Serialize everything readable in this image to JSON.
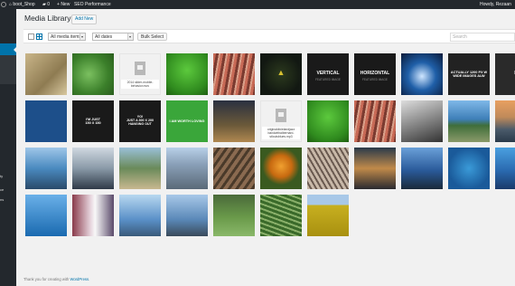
{
  "adminbar": {
    "site_name": "boot_Shop",
    "comments_count": "0",
    "new_label": "New",
    "seo_label": "SEO",
    "perf_label": "Performance",
    "howdy": "Howdy, Rezaan"
  },
  "sidebar": {
    "items": [
      "",
      "",
      "",
      "",
      "",
      "",
      "",
      "",
      "",
      "",
      "",
      "",
      "",
      "ty",
      "",
      "ce",
      "",
      "ns",
      "",
      ""
    ]
  },
  "header": {
    "title": "Media Library",
    "add_new": "Add New"
  },
  "toolbar": {
    "filter_type": "All media items",
    "filter_date": "All dates",
    "bulk_select": "Bulk Select",
    "search_placeholder": "Search"
  },
  "tiles": [
    {
      "kind": "image",
      "name": "glasses-on-book",
      "bg": "linear-gradient(135deg,#c9b589,#8e7b52 60%,#d8c9a0)"
    },
    {
      "kind": "image",
      "name": "green-fern",
      "bg": "radial-gradient(circle at 40% 50%,#7bc060,#3b7f2a 60%,#2b5e1e)"
    },
    {
      "kind": "file",
      "name": "video-file",
      "label": "2014 slider-mobile-behavior.mov"
    },
    {
      "kind": "image",
      "name": "green-dew",
      "bg": "radial-gradient(circle at 50% 40%,#5cc93d,#2f8a1e 70%,#1f5f12)"
    },
    {
      "kind": "image",
      "name": "red-coral",
      "bg": "repeating-linear-gradient(100deg,#c86a56 0 3px,#7b3b30 3px 6px,#d9a08a 6px 8px)"
    },
    {
      "kind": "image",
      "name": "triforce-dark",
      "bg": "radial-gradient(circle,#2c3a1e,#121812 70%)",
      "glyph": "▲"
    },
    {
      "kind": "image",
      "name": "vertical-featured",
      "bg": "#1a1a1a",
      "text": "VERTICAL",
      "sub": "FEATURED IMAGE"
    },
    {
      "kind": "image",
      "name": "horizontal-featured",
      "bg": "#1a1a1a",
      "text": "HORIZONTAL",
      "sub": "FEATURED IMAGE"
    },
    {
      "kind": "image",
      "name": "unicorn",
      "bg": "radial-gradient(circle at 50% 55%,#cfe6ff,#1f5fa8 45%,#0a1a3a)"
    },
    {
      "kind": "image",
      "name": "wide-image-text",
      "bg": "#222",
      "text": "ACTUALLY 1200 PX W\nWIDE IMAGES ALW"
    },
    {
      "kind": "image",
      "name": "partial-dark",
      "bg": "#2a2a2a",
      "text": "R"
    },
    {
      "kind": "image",
      "name": "blue-tile",
      "bg": "#1d4f8a"
    },
    {
      "kind": "image",
      "name": "150x150",
      "bg": "#1a1a1a",
      "text": "I'M JUST\n150 X 150"
    },
    {
      "kind": "image",
      "name": "300x200",
      "bg": "#1a1a1a",
      "text": "YO!\nJUST A 300 X 200\nHANGING OUT"
    },
    {
      "kind": "image",
      "name": "green-text",
      "bg": "#3aa63a",
      "text": "I AM WORTH LOVING"
    },
    {
      "kind": "image",
      "name": "city-night",
      "bg": "linear-gradient(180deg,#2a3040,#6c5a3a 60%,#b08850)"
    },
    {
      "kind": "file",
      "name": "audio-file",
      "label": "originaldixielandjazz bandwithalbernard-stlouisblues.mp3"
    },
    {
      "kind": "image",
      "name": "green-dew-2",
      "bg": "radial-gradient(circle at 50% 40%,#5cc93d,#2f8a1e 70%,#1f5f12)"
    },
    {
      "kind": "image",
      "name": "red-coral-2",
      "bg": "repeating-linear-gradient(100deg,#c86a56 0 3px,#7b3b30 3px 6px,#d9a08a 6px 8px)"
    },
    {
      "kind": "image",
      "name": "bw-landscape",
      "bg": "linear-gradient(160deg,#ddd,#888 50%,#333)"
    },
    {
      "kind": "image",
      "name": "coast-cliffs",
      "bg": "linear-gradient(180deg,#7fb8e8,#3e7fb8 45%,#3f6e3a 60%,#8a9a6a)"
    },
    {
      "kind": "image",
      "name": "sunset-shore",
      "bg": "linear-gradient(180deg,#e8a060,#c08a5a 40%,#4a5a6a 70%,#2a3a4a)"
    },
    {
      "kind": "image",
      "name": "sea-cliffs",
      "bg": "linear-gradient(180deg,#9fc6e8,#4a8ac0 50%,#2a4a6a)"
    },
    {
      "kind": "image",
      "name": "misty-lake",
      "bg": "linear-gradient(180deg,#d0d8e0,#8a9aa8 50%,#2f3a48)"
    },
    {
      "kind": "image",
      "name": "beach-arch",
      "bg": "linear-gradient(180deg,#9ac0d8,#6a8a5a 50%,#c8b890)"
    },
    {
      "kind": "image",
      "name": "rocky-shore",
      "bg": "linear-gradient(180deg,#b8d0e8,#8aa0b8 40%,#5a6a78)"
    },
    {
      "kind": "image",
      "name": "wood-boardwalk",
      "bg": "repeating-linear-gradient(125deg,#8a6a50 0 4px,#4a3a2a 4px 7px)"
    },
    {
      "kind": "image",
      "name": "orange-lily",
      "bg": "radial-gradient(circle at 50% 45%,#f0a030,#c86a10 35%,#3a5a20 60%)"
    },
    {
      "kind": "image",
      "name": "metal-structure",
      "bg": "repeating-linear-gradient(60deg,#c8b8a8 0 3px,#6a5a50 3px 5px)"
    },
    {
      "kind": "image",
      "name": "sunset-water",
      "bg": "linear-gradient(180deg,#2a3a4a,#c08a4a 50%,#2a2a30)"
    },
    {
      "kind": "image",
      "name": "harbour-bridge",
      "bg": "linear-gradient(180deg,#6aa0d8,#2a5a9a 55%,#1a2a3a)"
    },
    {
      "kind": "image",
      "name": "blue-water",
      "bg": "radial-gradient(circle,#3a9ad8,#1a5a9a 70%)"
    },
    {
      "kind": "image",
      "name": "city-skyline",
      "bg": "linear-gradient(180deg,#4aa0e0,#2a6ab0 55%,#1a3a6a)"
    },
    {
      "kind": "image",
      "name": "blue-sea",
      "bg": "linear-gradient(180deg,#6ab0e8,#1a6ab0)"
    },
    {
      "kind": "image",
      "name": "light-rays",
      "bg": "linear-gradient(90deg,#8a3a4a,#e8d8e0 45%,#f8f8f8 55%,#5a4a6a)"
    },
    {
      "kind": "image",
      "name": "golden-gate",
      "bg": "linear-gradient(180deg,#b8d8f0,#5a90c8 60%,#3a5a7a)"
    },
    {
      "kind": "image",
      "name": "pier-bridge",
      "bg": "linear-gradient(180deg,#a8c8e8,#5a88b8 60%,#3a4a5a)"
    },
    {
      "kind": "image",
      "name": "forest",
      "bg": "linear-gradient(180deg,#4a6a3a,#6a9a4a 55%,#8ab86a)"
    },
    {
      "kind": "image",
      "name": "crop-rows",
      "bg": "repeating-linear-gradient(20deg,#3a6a2a 0 3px,#8ab06a 3px 5px)"
    },
    {
      "kind": "image",
      "name": "yellow-field",
      "bg": "linear-gradient(180deg,#a8c8e8 0 25%,#c8b020 25%,#a89010)"
    }
  ],
  "footer": {
    "text": "Thank you for creating with",
    "link": "WordPress"
  }
}
